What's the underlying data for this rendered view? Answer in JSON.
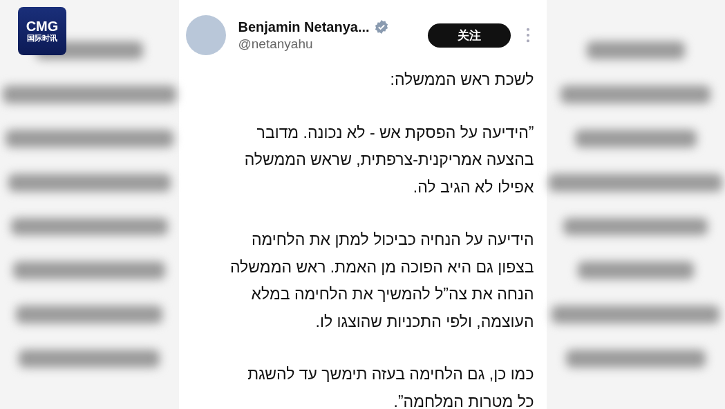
{
  "channel_logo": {
    "title": "CMG",
    "subtitle": "国际时讯"
  },
  "post": {
    "author": {
      "name": "Benjamin Netanya...",
      "handle": "@netanyahu",
      "verified": true
    },
    "follow_button": {
      "label": "关注"
    },
    "paragraphs": [
      {
        "lines": [
          "לשכת ראש הממשלה:"
        ]
      },
      {
        "lines": [
          "”הידיעה על הפסקת אש - לא נכונה. מדובר",
          "בהצעה אמריקנית-צרפתית, שראש הממשלה",
          "אפילו לא הגיב לה."
        ]
      },
      {
        "lines": [
          "הידיעה על הנחיה כביכול למתן את הלחימה",
          "בצפון גם היא הפוכה מן האמת. ראש הממשלה",
          "הנחה את צה”ל להמשיך את הלחימה במלא",
          "העוצמה, ולפי התכניות שהוצגו לו."
        ]
      },
      {
        "lines": [
          "כמו כן, גם הלחימה בעזה תימשך עד להשגת",
          "כל מטרות המלחמה”."
        ]
      }
    ]
  }
}
